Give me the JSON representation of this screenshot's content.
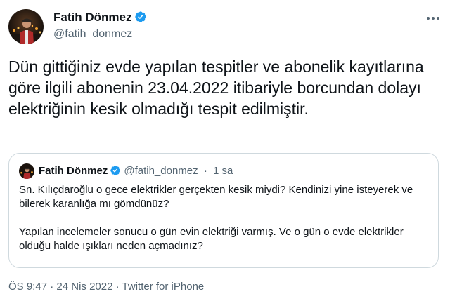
{
  "author": {
    "name": "Fatih Dönmez",
    "handle": "@fatih_donmez"
  },
  "tweet": {
    "text": "Dün gittiğiniz evde yapılan tespitler ve abonelik kayıtlarına göre ilgili abonenin 23.04.2022 itibariyle borcundan dolayı elektriğinin kesik olmadığı tespit edilmiştir."
  },
  "quoted": {
    "name": "Fatih Dönmez",
    "handle": "@fatih_donmez",
    "separator": "·",
    "time": "1 sa",
    "paragraph1": "Sn. Kılıçdaroğlu o gece elektrikler gerçekten kesik miydi? Kendinizi yine isteyerek ve bilerek karanlığa mı gömdünüz?",
    "paragraph2": "Yapılan incelemeler sonucu o gün evin elektriği varmış. Ve o gün o evde elektrikler olduğu halde ışıkları neden açmadınız?"
  },
  "footer": {
    "time": "ÖS 9:47",
    "sep1": "·",
    "date": "24 Nis 2022",
    "sep2": "·",
    "source": "Twitter for iPhone"
  },
  "icons": {
    "verified": "verified-badge-icon",
    "more": "more-options-icon"
  },
  "colors": {
    "verified": "#1d9bf0",
    "secondary_text": "#536471",
    "primary_text": "#0f1419",
    "border": "#cfd9de"
  }
}
